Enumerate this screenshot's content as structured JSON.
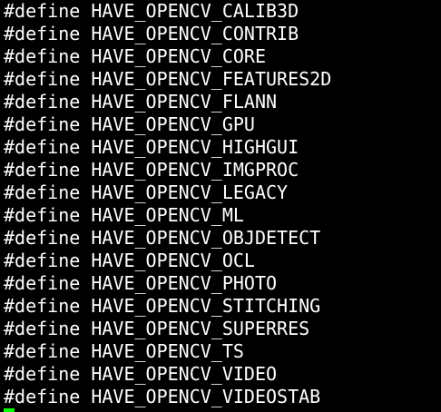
{
  "terminal": {
    "lines": [
      "#define HAVE_OPENCV_CALIB3D",
      "#define HAVE_OPENCV_CONTRIB",
      "#define HAVE_OPENCV_CORE",
      "#define HAVE_OPENCV_FEATURES2D",
      "#define HAVE_OPENCV_FLANN",
      "#define HAVE_OPENCV_GPU",
      "#define HAVE_OPENCV_HIGHGUI",
      "#define HAVE_OPENCV_IMGPROC",
      "#define HAVE_OPENCV_LEGACY",
      "#define HAVE_OPENCV_ML",
      "#define HAVE_OPENCV_OBJDETECT",
      "#define HAVE_OPENCV_OCL",
      "#define HAVE_OPENCV_PHOTO",
      "#define HAVE_OPENCV_STITCHING",
      "#define HAVE_OPENCV_SUPERRES",
      "#define HAVE_OPENCV_TS",
      "#define HAVE_OPENCV_VIDEO",
      "#define HAVE_OPENCV_VIDEOSTAB"
    ]
  },
  "colors": {
    "background": "#000000",
    "text": "#ffffff",
    "cursor": "#00ff00"
  }
}
